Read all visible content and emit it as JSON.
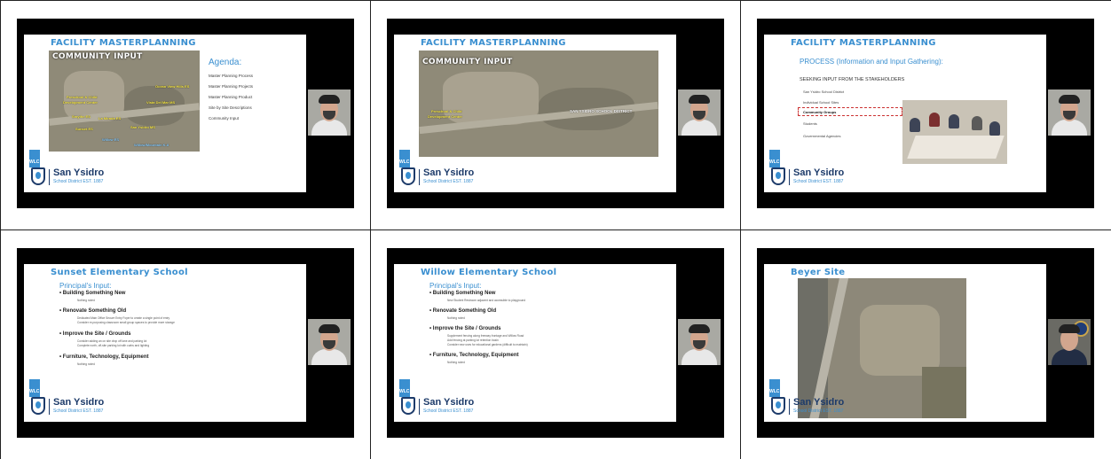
{
  "slides": {
    "s1": {
      "title": "FACILITY MASTERPLANNING",
      "map_label": "COMMUNITY INPUT",
      "pins": [
        "Preschool & Child",
        "Development Center",
        "La Mirada ES",
        "Smythe ES",
        "Sunset ES",
        "Willow ES",
        "Ocean View Hills ES",
        "Vista Del Mar MS",
        "San Ysidro MS",
        "Willow/Mountain K-8"
      ],
      "agenda_title": "Agenda:",
      "agenda_items": [
        "Master Planning Process",
        "Master Planning Projects",
        "Master Planning Product",
        "Site by Site Descriptions",
        "Community Input"
      ]
    },
    "s2": {
      "title": "FACILITY MASTERPLANNING",
      "map_label": "COMMUNITY INPUT",
      "district_label": "SAN YSIDRO SCHOOL DISTRICT",
      "pins": [
        "Preschool & Child",
        "Development Center"
      ]
    },
    "s3": {
      "title": "FACILITY MASTERPLANNING",
      "heading": "PROCESS (Information and Input Gathering):",
      "sub": "SEEKING INPUT FROM THE STAKEHOLDERS",
      "bullets": [
        "San Ysidro School District",
        "Individual School Sites",
        "Community Groups",
        "Students",
        "Governmental Agencies"
      ]
    },
    "s4": {
      "title": "Sunset Elementary School",
      "input_title": "Principal's Input:",
      "sections": [
        {
          "label": "Building Something New",
          "notes": [
            "Nothing noted"
          ]
        },
        {
          "label": "Renovate Something Old",
          "notes": [
            "Dedicated Main Office Secure Entry Foyer to create a single point of entry",
            "Consider re-purposing classroom small group spaces to provide more storage"
          ]
        },
        {
          "label": "Improve the Site / Grounds",
          "notes": [
            "Consider adding an on site drop off lane and parking lot",
            "Complete north, off-site parking lot with curbs and lighting"
          ]
        },
        {
          "label": "Furniture, Technology, Equipment",
          "notes": [
            "Nothing noted"
          ]
        }
      ]
    },
    "s5": {
      "title": "Willow Elementary School",
      "input_title": "Principal's Input:",
      "sections": [
        {
          "label": "Building Something New",
          "notes": [
            "New Student Restroom adjacent and accessible to playground"
          ]
        },
        {
          "label": "Renovate Something Old",
          "notes": [
            "Nothing noted"
          ]
        },
        {
          "label": "Improve the Site / Grounds",
          "notes": [
            "Supplement fencing along freeway frontage and Willow Road",
            "Add fencing at parking lot retention basin",
            "Consider new uses for educational gardens (difficult to maintain)"
          ]
        },
        {
          "label": "Furniture, Technology, Equipment",
          "notes": [
            "Nothing noted"
          ]
        }
      ]
    },
    "s6": {
      "title": "Beyer Site"
    }
  },
  "branding": {
    "wlc": "WLC",
    "district_name": "San Ysidro",
    "district_sub": "School District  EST. 1887"
  }
}
